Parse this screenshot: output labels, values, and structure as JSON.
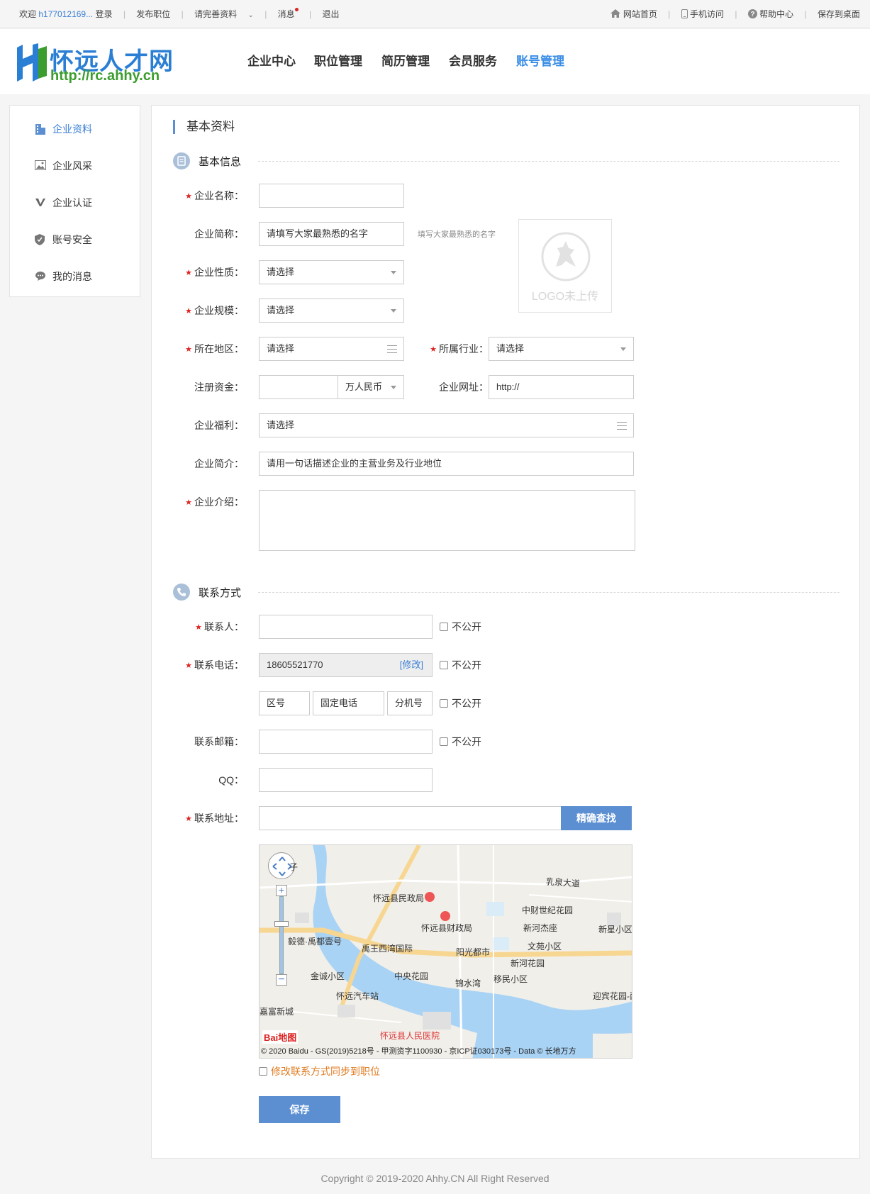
{
  "topbar": {
    "welcome": "欢迎",
    "username": "h177012169...",
    "login": "登录",
    "post_job": "发布职位",
    "complete_info": "请完善资料",
    "messages": "消息",
    "logout": "退出",
    "site_home": "网站首页",
    "mobile": "手机访问",
    "help": "帮助中心",
    "save_desktop": "保存到桌面"
  },
  "logo": {
    "name": "怀远人才网",
    "url": "http://rc.ahhy.cn"
  },
  "nav": [
    "企业中心",
    "职位管理",
    "简历管理",
    "会员服务",
    "账号管理"
  ],
  "nav_active": "账号管理",
  "sidebar": {
    "items": [
      {
        "label": "企业资料",
        "icon": "building-icon"
      },
      {
        "label": "企业风采",
        "icon": "image-icon"
      },
      {
        "label": "企业认证",
        "icon": "verify-v-icon"
      },
      {
        "label": "账号安全",
        "icon": "shield-icon"
      },
      {
        "label": "我的消息",
        "icon": "chat-bubble-icon"
      }
    ],
    "active_index": 0
  },
  "page_title": "基本资料",
  "basic": {
    "heading": "基本信息",
    "company_name": {
      "label": "企业名称：",
      "value": ""
    },
    "short_name": {
      "label": "企业简称：",
      "placeholder": "请填写大家最熟悉的名字",
      "hint": "填写大家最熟悉的名字"
    },
    "nature": {
      "label": "企业性质：",
      "value": "请选择"
    },
    "scale": {
      "label": "企业规模：",
      "value": "请选择"
    },
    "region": {
      "label": "所在地区：",
      "value": "请选择"
    },
    "industry": {
      "label": "所属行业：",
      "value": "请选择"
    },
    "capital": {
      "label": "注册资金：",
      "value": "",
      "unit": "万人民币"
    },
    "website": {
      "label": "企业网址：",
      "value": "http://"
    },
    "welfare": {
      "label": "企业福利：",
      "value": "请选择"
    },
    "summary": {
      "label": "企业简介：",
      "placeholder": "请用一句话描述企业的主营业务及行业地位"
    },
    "intro": {
      "label": "企业介绍：",
      "value": ""
    },
    "logo_placeholder": "LOGO未上传"
  },
  "contact": {
    "heading": "联系方式",
    "person": {
      "label": "联系人：",
      "value": ""
    },
    "phone": {
      "label": "联系电话：",
      "value": "18605521770",
      "edit": "[修改]"
    },
    "area_code": "区号",
    "landline": "固定电话",
    "extension": "分机号",
    "email": {
      "label": "联系邮箱：",
      "value": ""
    },
    "qq": {
      "label": "QQ：",
      "value": ""
    },
    "address": {
      "label": "联系地址：",
      "value": ""
    },
    "search_btn": "精确查找",
    "hide": "不公开",
    "sync": "修改联系方式同步到职位",
    "save": "保存"
  },
  "map": {
    "labels": {
      "civil": "怀远县民政局",
      "finance": "怀远县财政局",
      "yuwang": "禹王西湾国际",
      "yide": "毅德·禹都壹号",
      "zhongcai": "中财世纪花园",
      "xinhe_jie": "新河杰座",
      "wenyuan": "文苑小区",
      "xinhe_garden": "新河花园",
      "yangguang": "阳光都市",
      "zhongyang": "中央花园",
      "jinshui": "锦水湾",
      "yimin": "移民小区",
      "jincheng": "金诚小区",
      "bus": "怀远汽车站",
      "hospital": "怀远县人民医院",
      "jiafu": "嘉富新城",
      "yingbin": "迎宾花园-西",
      "xinxing": "新星小区",
      "ruquan": "乳泉大道",
      "zi": "子"
    },
    "attribution": "© 2020 Baidu - GS(2019)5218号 - 甲测资字1100930 - 京ICP证030173号 - Data © 长地万方",
    "brand": "Bai地图"
  },
  "footer": {
    "copyright": "Copyright © 2019-2020 Ahhy.CN All Right Reserved"
  },
  "colors": {
    "accent": "#5b8fd1",
    "nav_active": "#3a8ee6",
    "required": "#dd2222",
    "sync_text": "#e07a1f"
  }
}
